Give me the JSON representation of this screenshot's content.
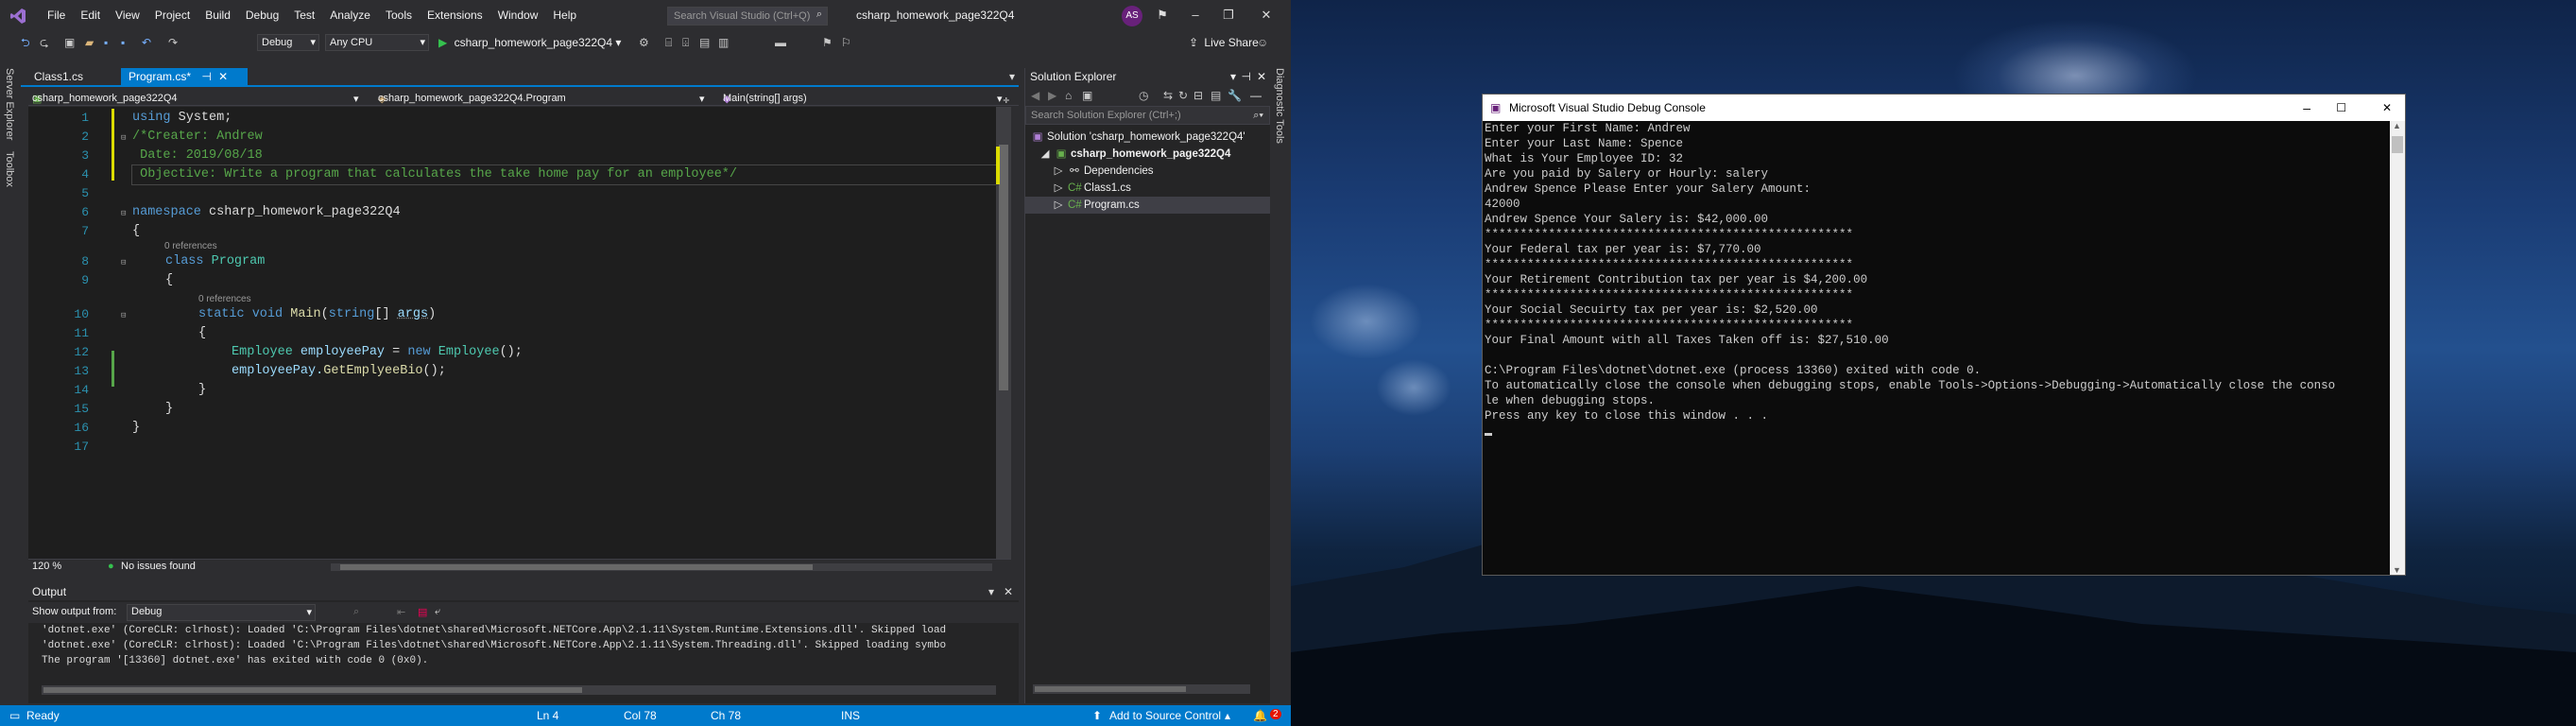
{
  "vs": {
    "menu": [
      "File",
      "Edit",
      "View",
      "Project",
      "Build",
      "Debug",
      "Test",
      "Analyze",
      "Tools",
      "Extensions",
      "Window",
      "Help"
    ],
    "search_placeholder": "Search Visual Studio (Ctrl+Q)",
    "solution_title": "csharp_homework_page322Q4",
    "avatar": "AS",
    "toolbar": {
      "config": "Debug",
      "platform": "Any CPU",
      "run_target": "csharp_homework_page322Q4",
      "live_share": "Live Share"
    },
    "side_tabs": {
      "left1": "Server Explorer",
      "left2": "Toolbox",
      "right1": "Diagnostic Tools"
    },
    "tabs": [
      {
        "label": "Class1.cs"
      },
      {
        "label": "Program.cs*"
      }
    ],
    "nav": {
      "project": "csharp_homework_page322Q4",
      "class": "csharp_homework_page322Q4.Program",
      "member": "Main(string[] args)"
    },
    "code_lines": [
      {
        "n": "1"
      },
      {
        "n": "2"
      },
      {
        "n": "3"
      },
      {
        "n": "4"
      },
      {
        "n": "5"
      },
      {
        "n": "6"
      },
      {
        "n": "7"
      },
      {
        "n": "8"
      },
      {
        "n": "9"
      },
      {
        "n": "10"
      },
      {
        "n": "11"
      },
      {
        "n": "12"
      },
      {
        "n": "13"
      },
      {
        "n": "14"
      },
      {
        "n": "15"
      },
      {
        "n": "16"
      },
      {
        "n": "17"
      }
    ],
    "code": {
      "l1a": "using",
      "l1b": " System;",
      "l2": "/*Creater: Andrew",
      "l3": " Date: 2019/08/18",
      "l4": " Objective: Write a program that calculates the take home pay for an employee*/",
      "l6a": "namespace",
      "l6b": " csharp_homework_page322Q4",
      "l7": "{",
      "ref1": "0 references",
      "l8a": "class",
      "l8b": " Program",
      "l9": "{",
      "ref2": "0 references",
      "l10a": "static",
      "l10b": " void",
      "l10c": " Main",
      "l10d": "(",
      "l10e": "string",
      "l10f": "[] ",
      "l10g": "args",
      "l10h": ")",
      "l11": "{",
      "l12a": "Employee",
      "l12b": " employeePay",
      "l12c": " = ",
      "l12d": "new",
      "l12e": " Employee",
      "l12f": "();",
      "l13a": "employeePay.",
      "l13b": "GetEmplyeeBio",
      "l13c": "();",
      "l14": "}",
      "l15": "}",
      "l16": "}"
    },
    "editor_status": {
      "zoom": "120 %",
      "issues": "No issues found"
    },
    "output": {
      "title": "Output",
      "show_from_label": "Show output from:",
      "show_from_value": "Debug",
      "lines": [
        "'dotnet.exe' (CoreCLR: clrhost): Loaded 'C:\\Program Files\\dotnet\\shared\\Microsoft.NETCore.App\\2.1.11\\System.Runtime.Extensions.dll'. Skipped load",
        "'dotnet.exe' (CoreCLR: clrhost): Loaded 'C:\\Program Files\\dotnet\\shared\\Microsoft.NETCore.App\\2.1.11\\System.Threading.dll'. Skipped loading symbo",
        "The program '[13360] dotnet.exe' has exited with code 0 (0x0)."
      ]
    },
    "solution_explorer": {
      "title": "Solution Explorer",
      "search_placeholder": "Search Solution Explorer (Ctrl+;)",
      "solution": "Solution 'csharp_homework_page322Q4'",
      "project": "csharp_homework_page322Q4",
      "items": [
        "Dependencies",
        "Class1.cs",
        "Program.cs"
      ]
    },
    "status": {
      "ready": "Ready",
      "ln": "Ln 4",
      "col": "Col 78",
      "ch": "Ch 78",
      "ins": "INS",
      "source_control": "Add to Source Control",
      "notifications": "2"
    }
  },
  "console": {
    "title": "Microsoft Visual Studio Debug Console",
    "lines": [
      "Enter your First Name: Andrew",
      "Enter your Last Name: Spence",
      "What is Your Employee ID: 32",
      "Are you paid by Salery or Hourly: salery",
      "Andrew Spence Please Enter your Salery Amount:",
      "42000",
      "Andrew Spence Your Salery is: $42,000.00",
      "****************************************************",
      "Your Federal tax per year is: $7,770.00",
      "****************************************************",
      "Your Retirement Contribution tax per year is $4,200.00",
      "****************************************************",
      "Your Social Secuirty tax per year is: $2,520.00",
      "****************************************************",
      "Your Final Amount with all Taxes Taken off is: $27,510.00",
      "",
      "C:\\Program Files\\dotnet\\dotnet.exe (process 13360) exited with code 0.",
      "To automatically close the console when debugging stops, enable Tools->Options->Debugging->Automatically close the conso",
      "le when debugging stops.",
      "Press any key to close this window . . ."
    ]
  },
  "colors": {
    "accent": "#007acc",
    "ide_bg": "#2d2d30",
    "editor_bg": "#1e1e1e",
    "console_bg": "#0c0c0c"
  }
}
